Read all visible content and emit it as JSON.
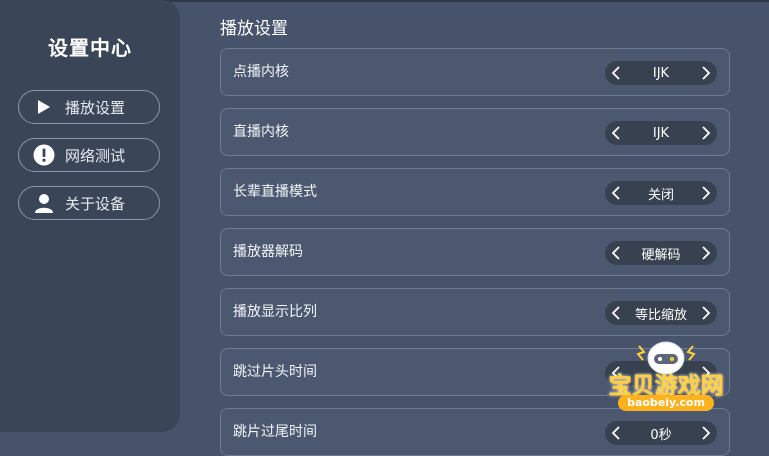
{
  "sidebar": {
    "title": "设置中心",
    "items": [
      {
        "label": "播放设置",
        "icon": "play-icon"
      },
      {
        "label": "网络测试",
        "icon": "alert-icon"
      },
      {
        "label": "关于设备",
        "icon": "user-icon"
      }
    ]
  },
  "content": {
    "title": "播放设置",
    "settings": [
      {
        "label": "点播内核",
        "value": "IJK"
      },
      {
        "label": "直播内核",
        "value": "IJK"
      },
      {
        "label": "长辈直播模式",
        "value": "关闭"
      },
      {
        "label": "播放器解码",
        "value": "硬解码"
      },
      {
        "label": "播放显示比列",
        "value": "等比缩放"
      },
      {
        "label": "跳过片头时间",
        "value": ""
      },
      {
        "label": "跳片过尾时间",
        "value": "0秒"
      }
    ]
  },
  "watermark": {
    "text": "宝贝游戏网",
    "url": "baobeiy.com"
  },
  "colors": {
    "background": "#46536a",
    "sidebar": "#3a4557",
    "row": "#4b586f",
    "selector": "#37414f",
    "watermark": "#ffd23a"
  }
}
